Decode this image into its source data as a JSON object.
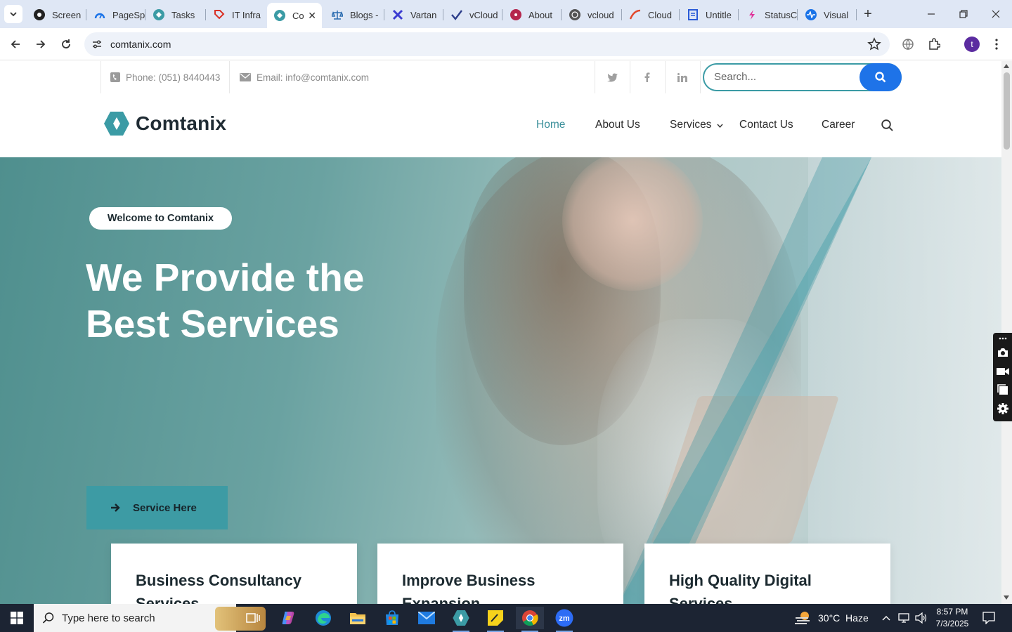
{
  "browser": {
    "tabs": [
      {
        "label": "Screen",
        "icon": "screencast-icon",
        "color": "#222222"
      },
      {
        "label": "PageSp",
        "icon": "pagespeed-icon",
        "color": "#1a73e8"
      },
      {
        "label": "Tasks",
        "icon": "comtanix-icon",
        "color": "#3b9ba5"
      },
      {
        "label": "IT Infra",
        "icon": "tag-icon",
        "color": "#d93025"
      },
      {
        "label": "Co",
        "icon": "comtanix-icon",
        "color": "#3b9ba5",
        "active": true
      },
      {
        "label": "Blogs -",
        "icon": "scale-icon",
        "color": "#2b6cb0"
      },
      {
        "label": "Vartan",
        "icon": "x-logo-icon",
        "color": "#3b3bd1"
      },
      {
        "label": "vCloud",
        "icon": "check-logo-icon",
        "color": "#2d3e8a"
      },
      {
        "label": "About",
        "icon": "flower-icon",
        "color": "#b5264d"
      },
      {
        "label": "vcloud",
        "icon": "globe-icon",
        "color": "#555555"
      },
      {
        "label": "Cloud",
        "icon": "swoosh-icon",
        "color": "#e2472b"
      },
      {
        "label": "Untitle",
        "icon": "docs-icon",
        "color": "#2a5bd7"
      },
      {
        "label": "StatusC",
        "icon": "status-icon",
        "color": "#e0339a"
      },
      {
        "label": "Visual",
        "icon": "pulse-icon",
        "color": "#1a73e8"
      }
    ],
    "url": "comtanix.com",
    "profile_initial": "t"
  },
  "site": {
    "topbar": {
      "phone": "Phone: (051) 8440443",
      "email": "Email: info@comtanix.com",
      "search_placeholder": "Search..."
    },
    "logo_text": "Comtanix",
    "nav": {
      "home": "Home",
      "about": "About Us",
      "services": "Services",
      "contact": "Contact Us",
      "career": "Career"
    },
    "hero": {
      "welcome": "Welcome to Comtanix",
      "title_line1": "We Provide the",
      "title_line2": "Best Services",
      "button": "Service Here"
    },
    "cards": [
      {
        "title": "Business Consultancy Services"
      },
      {
        "title": "Improve Business Expansion"
      },
      {
        "title": "High Quality Digital Services"
      }
    ],
    "colors": {
      "accent": "#3b9ba5",
      "search_button": "#1e73e8",
      "active_nav": "#3a8f9a"
    }
  },
  "taskbar": {
    "search_placeholder": "Type here to search",
    "weather": "30°C  Haze",
    "time": "8:57 PM",
    "date": "7/3/2025"
  }
}
